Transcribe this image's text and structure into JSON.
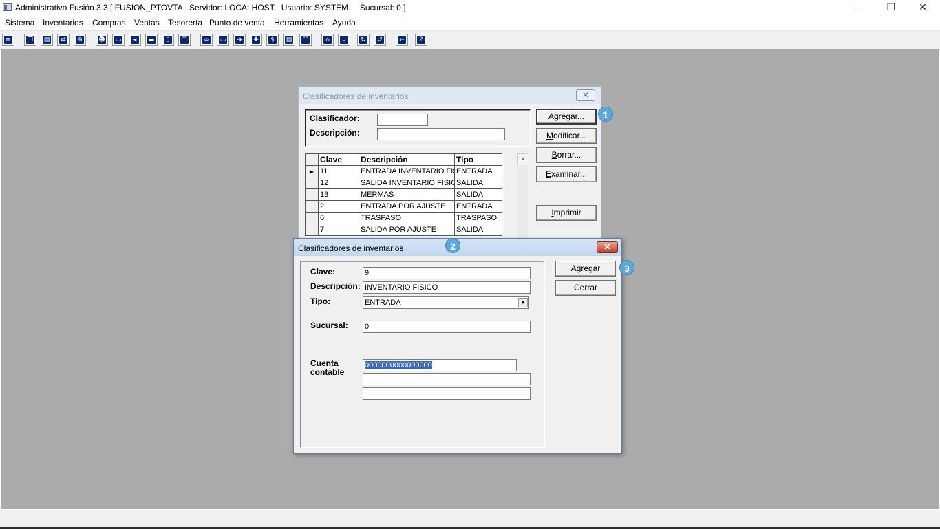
{
  "window": {
    "title": "Administrativo Fusión 3.3 [ FUSION_PTOVTA   Servidor: LOCALHOST   Usuario: SYSTEM     Sucursal: 0 ]",
    "minimize": "—",
    "restore": "❐",
    "close": "✕"
  },
  "menu": [
    "Sistema",
    "Inventarios",
    "Compras",
    "Ventas",
    "Tesorería",
    "Punto de venta",
    "Herramientas",
    "Ayuda"
  ],
  "toolbar_icons": [
    "calculator-icon",
    "copy-icon",
    "clipboard-icon",
    "exchange-icon",
    "zoom-icon",
    "user-icon",
    "folder-icon",
    "print-left-icon",
    "print-icon",
    "document-icon",
    "list-icon",
    "binoculars-icon",
    "card-icon",
    "export-icon",
    "add-icon",
    "dollar-icon",
    "report-icon",
    "tree-icon",
    "home-icon",
    "search-icon",
    "refresh-icon",
    "undo-icon",
    "back-icon",
    "help-icon"
  ],
  "list_dialog": {
    "title": "Clasificadores de inventarios",
    "filter": {
      "clasificador_label": "Clasificador:",
      "clasificador_value": "",
      "descripcion_label": "Descripción:",
      "descripcion_value": ""
    },
    "buttons": {
      "agregar": "Agregar...",
      "modificar": "Modificar...",
      "borrar": "Borrar...",
      "examinar": "Examinar...",
      "imprimir": "Imprimir"
    },
    "grid": {
      "headers": [
        "Clave",
        "Descripción",
        "Tipo"
      ],
      "rows": [
        [
          "11",
          "ENTRADA INVENTARIO FISICO",
          "ENTRADA"
        ],
        [
          "12",
          "SALIDA INVENTARIO FISICO",
          "SALIDA"
        ],
        [
          "13",
          "MERMAS",
          "SALIDA"
        ],
        [
          "2",
          "ENTRADA POR AJUSTE",
          "ENTRADA"
        ],
        [
          "6",
          "TRASPASO",
          "TRASPASO"
        ],
        [
          "7",
          "SALIDA POR AJUSTE",
          "SALIDA"
        ]
      ],
      "current_row_marker": "▶"
    }
  },
  "edit_dialog": {
    "title": "Clasificadores de inventarios",
    "close": "✕",
    "labels": {
      "clave": "Clave:",
      "descripcion": "Descripción:",
      "tipo": "Tipo:",
      "sucursal": "Sucursal:",
      "cuenta": "Cuenta\ncontable"
    },
    "values": {
      "clave": "9",
      "descripcion": "INVENTARIO FISICO",
      "tipo": "ENTRADA",
      "sucursal": "0",
      "cuenta": "0000000000000000",
      "cuenta_desc1": "",
      "cuenta_desc2": ""
    },
    "buttons": {
      "agregar": "Agregar",
      "cerrar": "Cerrar"
    }
  },
  "steps": [
    "1",
    "2",
    "3"
  ],
  "colors": {
    "workspace": "#ababab",
    "step_badge": "#5aa8dc",
    "selection": "#3468c0"
  }
}
